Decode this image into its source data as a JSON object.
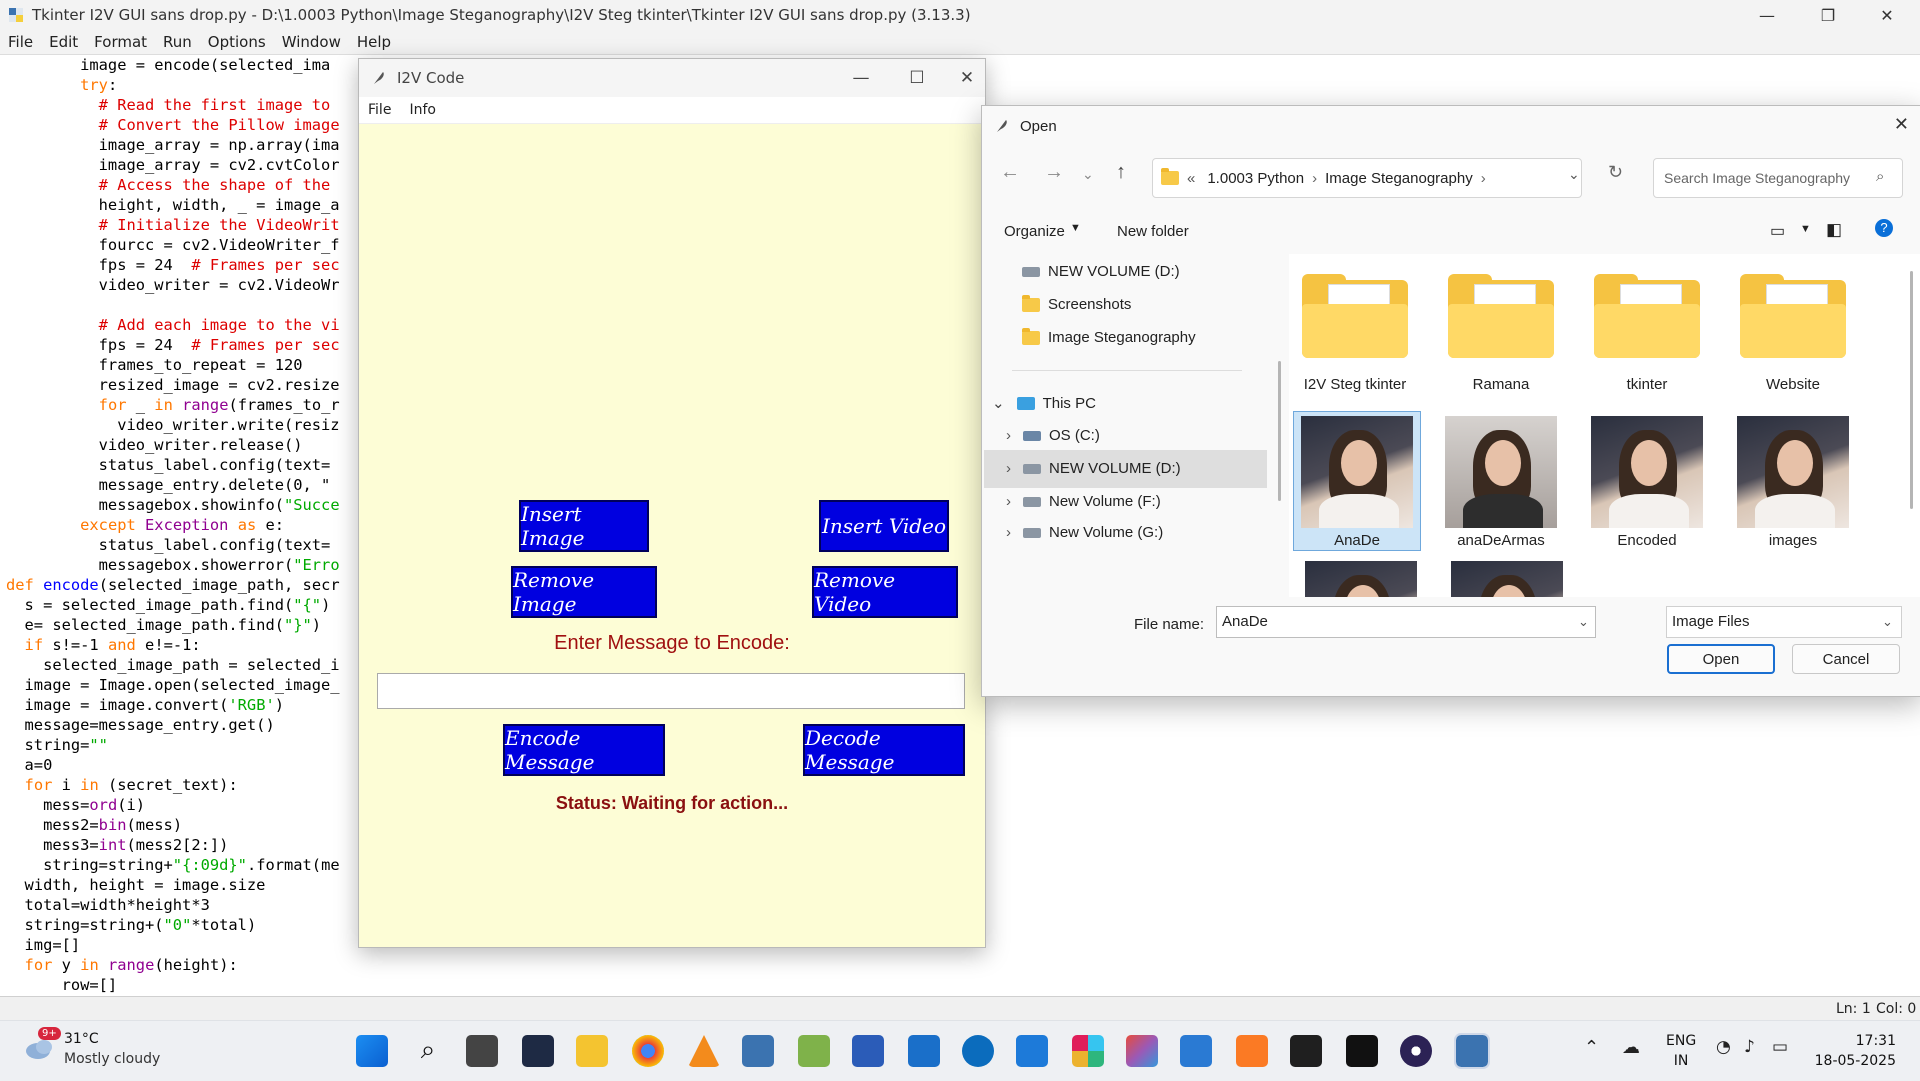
{
  "idle": {
    "title": "Tkinter I2V GUI sans drop.py - D:\\1.0003 Python\\Image Steganography\\I2V Steg tkinter\\Tkinter I2V GUI sans drop.py (3.13.3)",
    "menu": [
      "File",
      "Edit",
      "Format",
      "Run",
      "Options",
      "Window",
      "Help"
    ],
    "status": {
      "line": "Ln: 1",
      "col": "Col: 0"
    }
  },
  "i2v": {
    "title": "I2V Code",
    "menu": [
      "File",
      "Info"
    ],
    "buttons": {
      "insert_image": "Insert Image",
      "insert_video": "Insert Video",
      "remove_image": "Remove Image",
      "remove_video": "Remove Video",
      "encode": "Encode Message",
      "decode": "Decode Message"
    },
    "enter_label": "Enter Message to Encode:",
    "message_value": "",
    "status": "Status: Waiting for action...",
    "button_color": "#0000e0",
    "bg_color": "#fdfdd6"
  },
  "dialog": {
    "title": "Open",
    "breadcrumb": [
      "«",
      "1.0003 Python",
      "Image Steganography"
    ],
    "search_placeholder": "Search Image Steganography",
    "organize": "Organize",
    "new_folder": "New folder",
    "nav": {
      "quick": [
        "NEW VOLUME (D:)",
        "Screenshots",
        "Image Steganography"
      ],
      "this_pc": "This PC",
      "drives": [
        "OS (C:)",
        "NEW VOLUME (D:)",
        "New Volume (F:)",
        "New Volume (G:)"
      ]
    },
    "folders": [
      "I2V Steg tkinter",
      "Ramana",
      "tkinter",
      "Website"
    ],
    "images": [
      "AnaDe",
      "anaDeArmas",
      "Encoded",
      "images"
    ],
    "file_name_label": "File name:",
    "file_name_value": "AnaDe",
    "file_type": "Image Files",
    "open_label": "Open",
    "cancel_label": "Cancel"
  },
  "taskbar": {
    "weather_temp": "31°C",
    "weather_desc": "Mostly cloudy",
    "weather_badge": "9+",
    "lang1": "ENG",
    "lang2": "IN",
    "time": "17:31",
    "date": "18-05-2025"
  }
}
